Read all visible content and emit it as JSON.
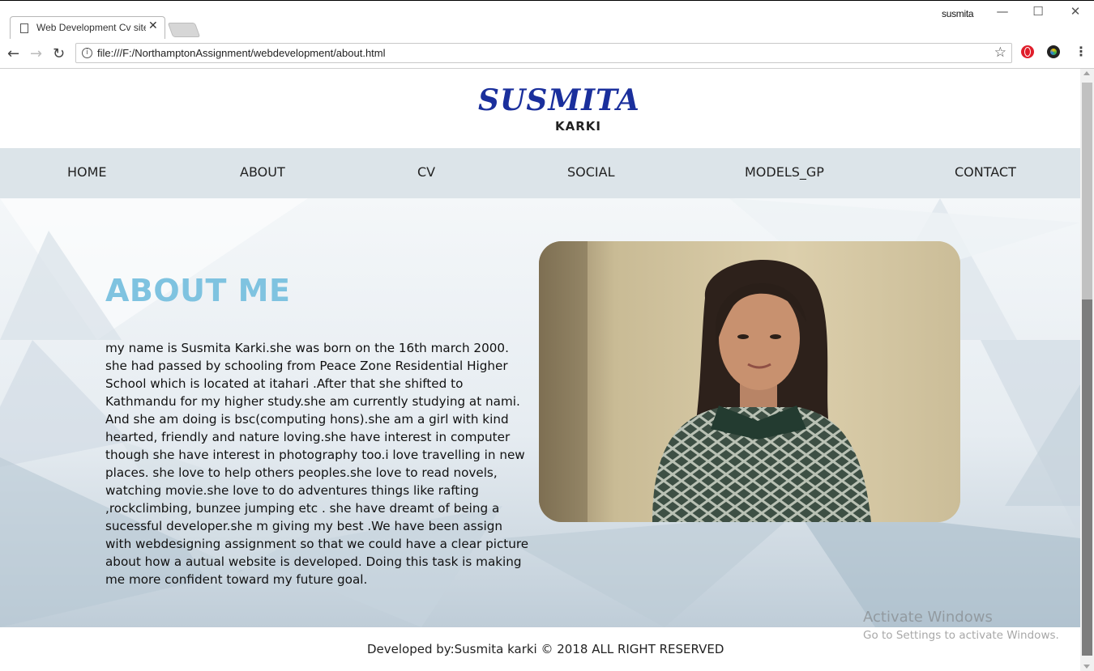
{
  "browser": {
    "tab_title": "Web Development Cv site",
    "user_name": "susmita",
    "url": "file:///F:/NorthamptonAssignment/webdevelopment/about.html",
    "window_buttons": {
      "minimize": "—",
      "maximize": "☐",
      "close": "✕"
    },
    "nav_glyphs": {
      "back": "←",
      "forward": "→",
      "reload": "↻"
    },
    "icons": [
      "page-icon",
      "close-icon",
      "info-icon",
      "star-icon",
      "opera-icon",
      "colorzilla-icon",
      "menu-icon"
    ]
  },
  "site": {
    "logo_main": "SUSMITA",
    "logo_sub": "KARKI",
    "nav": [
      "HOME",
      "ABOUT",
      "CV",
      "SOCIAL",
      "MODELS_GP",
      "CONTACT"
    ],
    "about": {
      "title": "ABOUT ME",
      "body": "my name is Susmita Karki.she was born on the 16th march 2000. she had passed by schooling from Peace Zone Residential Higher School which is located at itahari .After that she shifted to Kathmandu for my higher study.she am currently studying at nami. And she am doing is bsc(computing hons).she am a girl with kind hearted, friendly and nature loving.she have interest in computer though she have interest in photography too.i love travelling in new places. she love to help others peoples.she love to read novels, watching movie.she love to do adventures things like rafting ,rockclimbing, bunzee jumping etc . she have dreamt of being a sucessful developer.she m giving my best .We have been assign with webdesigning assignment so that we could have a clear picture about how a autual website is developed. Doing this task is making me more confident toward my future goal."
    },
    "footer": "Developed by:Susmita karki © 2018 ALL RIGHT RESERVED"
  },
  "os_overlay": {
    "activate_title": "Activate Windows",
    "activate_sub": "Go to Settings to activate Windows."
  },
  "colors": {
    "logo": "#1a2f9c",
    "about_title": "#7fc3e0",
    "navbar_bg": "#dce4e9"
  }
}
